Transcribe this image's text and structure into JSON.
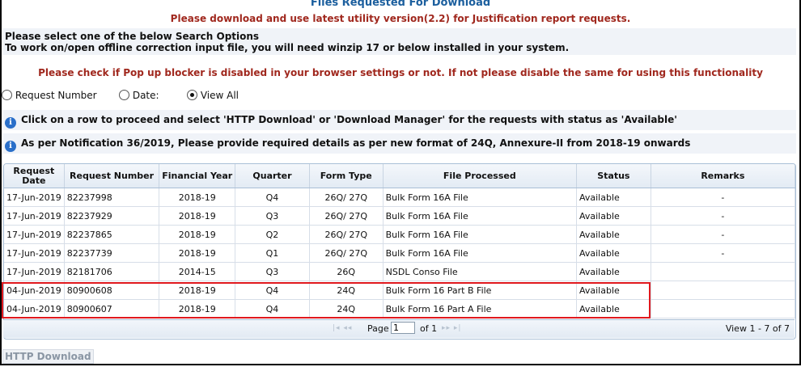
{
  "header": {
    "title": "Files Requested For Download",
    "utility_notice": "Please download and use latest utility version(2.2) for Justification report requests."
  },
  "options": {
    "line1": "Please select one of the below Search Options",
    "line2": "To work on/open offline correction input file, you will need winzip 17 or below installed in your system."
  },
  "popup_notice": "Please check if Pop up blocker is disabled in your browser settings or not. If not please disable the same for using this functionality",
  "search": {
    "radios": [
      {
        "label": "Request Number",
        "selected": false
      },
      {
        "label": "Date:",
        "selected": false
      },
      {
        "label": "View All",
        "selected": true
      }
    ]
  },
  "info": {
    "line1": "Click on a row to proceed and select 'HTTP Download' or 'Download Manager' for the requests with status as 'Available'",
    "line2": "As per Notification 36/2019, Please provide required details as per new format of 24Q, Annexure-II from 2018-19 onwards"
  },
  "table": {
    "headers": [
      "Request Date",
      "Request Number",
      "Financial Year",
      "Quarter",
      "Form Type",
      "File Processed",
      "Status",
      "Remarks"
    ],
    "rows": [
      [
        "17-Jun-2019",
        "82237998",
        "2018-19",
        "Q4",
        "26Q/ 27Q",
        "Bulk Form 16A File",
        "Available",
        "-"
      ],
      [
        "17-Jun-2019",
        "82237929",
        "2018-19",
        "Q3",
        "26Q/ 27Q",
        "Bulk Form 16A File",
        "Available",
        "-"
      ],
      [
        "17-Jun-2019",
        "82237865",
        "2018-19",
        "Q2",
        "26Q/ 27Q",
        "Bulk Form 16A File",
        "Available",
        "-"
      ],
      [
        "17-Jun-2019",
        "82237739",
        "2018-19",
        "Q1",
        "26Q/ 27Q",
        "Bulk Form 16A File",
        "Available",
        "-"
      ],
      [
        "17-Jun-2019",
        "82181706",
        "2014-15",
        "Q3",
        "26Q",
        "NSDL Conso File",
        "Available",
        ""
      ],
      [
        "04-Jun-2019",
        "80900608",
        "2018-19",
        "Q4",
        "24Q",
        "Bulk Form 16 Part B File",
        "Available",
        ""
      ],
      [
        "04-Jun-2019",
        "80900607",
        "2018-19",
        "Q4",
        "24Q",
        "Bulk Form 16 Part A File",
        "Available",
        ""
      ]
    ]
  },
  "pager": {
    "arrows_prev": "|◂ ◂◂",
    "page_label": "Page",
    "page_value": "1",
    "of_label": "of 1",
    "arrows_next": "▸▸ ▸|",
    "view_text": "View 1 - 7 of 7"
  },
  "actions": {
    "http_download": "HTTP Download"
  },
  "colors": {
    "title": "#1c5f9e",
    "notice": "#a0281e",
    "highlight": "#e0191e",
    "info_icon": "#2a6fc9"
  }
}
